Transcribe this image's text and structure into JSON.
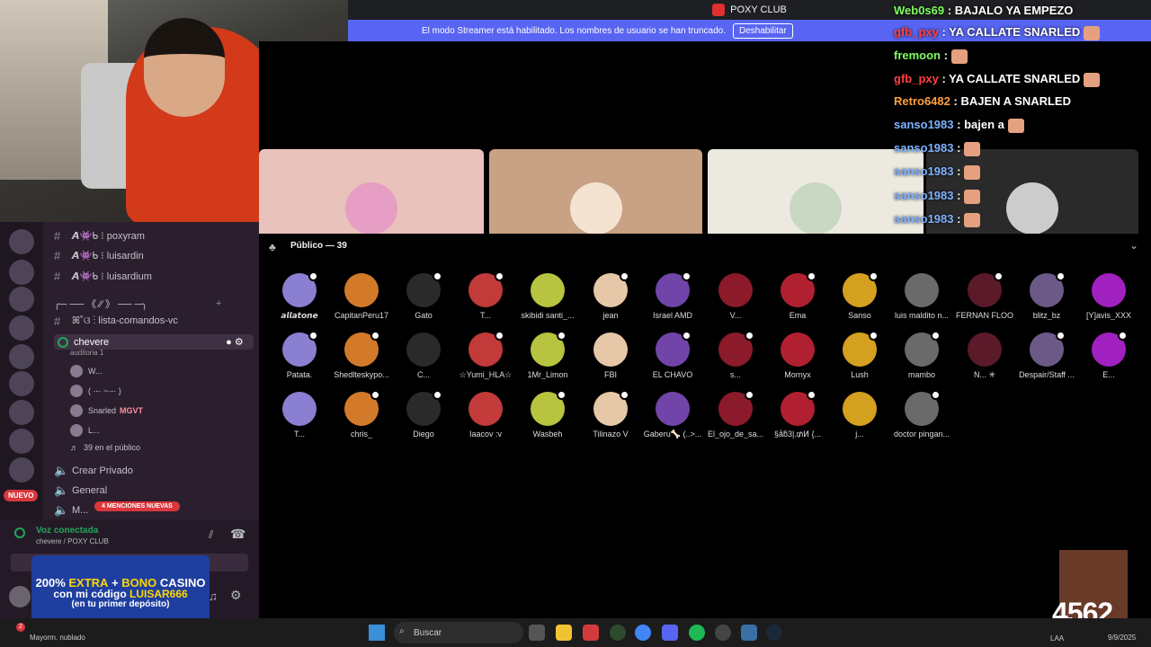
{
  "window": {
    "title": "POXY CLUB"
  },
  "streamer_banner": {
    "text": "El modo Streamer está habilitado. Los nombres de usuario se han truncado.",
    "button": "Deshabilitar"
  },
  "chat": [
    {
      "user": "Web0s69",
      "text": ": BAJALO YA EMPEZO",
      "color": "#7fff5f"
    },
    {
      "user": "gfb_pxy",
      "text": ": YA CALLATE SNARLED",
      "color": "#ff4040"
    },
    {
      "user": "fremoon",
      "text": ":",
      "color": "#7fff5f"
    },
    {
      "user": "gfb_pxy",
      "text": ": YA CALLATE SNARLED",
      "color": "#ff4040"
    },
    {
      "user": "Retro6482",
      "text": ": BAJEN A SNARLED",
      "color": "#ff9f3f"
    },
    {
      "user": "sanso1983",
      "text": ": bajen a",
      "color": "#7fb3ff"
    },
    {
      "user": "sanso1983",
      "text": ":",
      "color": "#7fb3ff"
    },
    {
      "user": "sanso1983",
      "text": ":",
      "color": "#7fb3ff"
    },
    {
      "user": "sanso1983",
      "text": ":",
      "color": "#7fb3ff"
    },
    {
      "user": "sanso1983",
      "text": ":",
      "color": "#7fb3ff"
    }
  ],
  "channels": [
    {
      "name": "poxyram",
      "icons": "𝘼👾ᑲ ⁝"
    },
    {
      "name": "luisardin",
      "icons": "𝘼👾ᑲ ⁝"
    },
    {
      "name": "luisardium",
      "icons": "𝘼👾ᑲ ⁝"
    }
  ],
  "category": "╭─ ── 《 ⁄⁄ 》 ── ─╮",
  "lista_channel": "ꕤ˚ଓ ⁝ lista-comandos-vc",
  "stage_channel": {
    "name": "chevere",
    "subtitle": "auditoria 1"
  },
  "stage_members": [
    {
      "name": "W..."
    },
    {
      "name": "( ·-· ~·-· )"
    },
    {
      "name": "Snarled",
      "badge": "MGVT"
    },
    {
      "name": "L..."
    }
  ],
  "audience_count_text": "39 en el público",
  "voice_channels": [
    "Crear Privado",
    "General",
    "M..."
  ],
  "new_badge": "NUEVO",
  "mentions_badge": "4 MENCIONES NUEVAS",
  "voice_status": {
    "title": "Voz conectada",
    "subtitle": "chevere / POXY CLUB"
  },
  "ad": {
    "line1_a": "200%",
    "line1_b": "EXTRA",
    "line1_c": "+",
    "line1_d": "BONO",
    "line1_e": "CASINO",
    "line2_a": "con mi código",
    "line2_b": "LUISAR666",
    "line3": "(en tu primer depósito)"
  },
  "audience_header": "Público — 39",
  "audience": [
    "𝙖𝙡𝙡𝙖𝙩𝙤𝙣𝙚",
    "CapitanPeru17",
    "Gato",
    "T...",
    "skibidi santi_...",
    "jean",
    "Israel AMD",
    "V...",
    "Ema",
    "Sanso",
    "luis maldito n...",
    "FERNAN FLOO",
    "blitz_bz",
    "[Y]avis_XXX",
    "Patata.",
    "Shedlteskypo...",
    "C...",
    "☆Yumi_HLA☆",
    "1Mr_Limon",
    "FBI",
    "EL CHAVO",
    "s...",
    "Mornyx",
    "Lush",
    "mambo",
    "N... ✳",
    "Despair/Staff ...",
    "E...",
    "T...",
    "chris_",
    "Diego",
    "Iaacov :v",
    "Wasbeh",
    "Tilinazo V",
    "Gaberu🦴 (..>...",
    "El_ojo_de_sa...",
    "§ǻƃ3|.₥Ͷ {...",
    "j...",
    "doctor pingan..."
  ],
  "taskbar": {
    "search_placeholder": "Buscar",
    "weather": "Mayorm. nublado",
    "date": "9/9/2025",
    "lang": "LAA",
    "notif_count": "2"
  },
  "streak": "4562",
  "colors": {
    "accent": "#5865f2",
    "stage_bg": "#000000",
    "sidebar_bg": "#2b1f2e"
  }
}
